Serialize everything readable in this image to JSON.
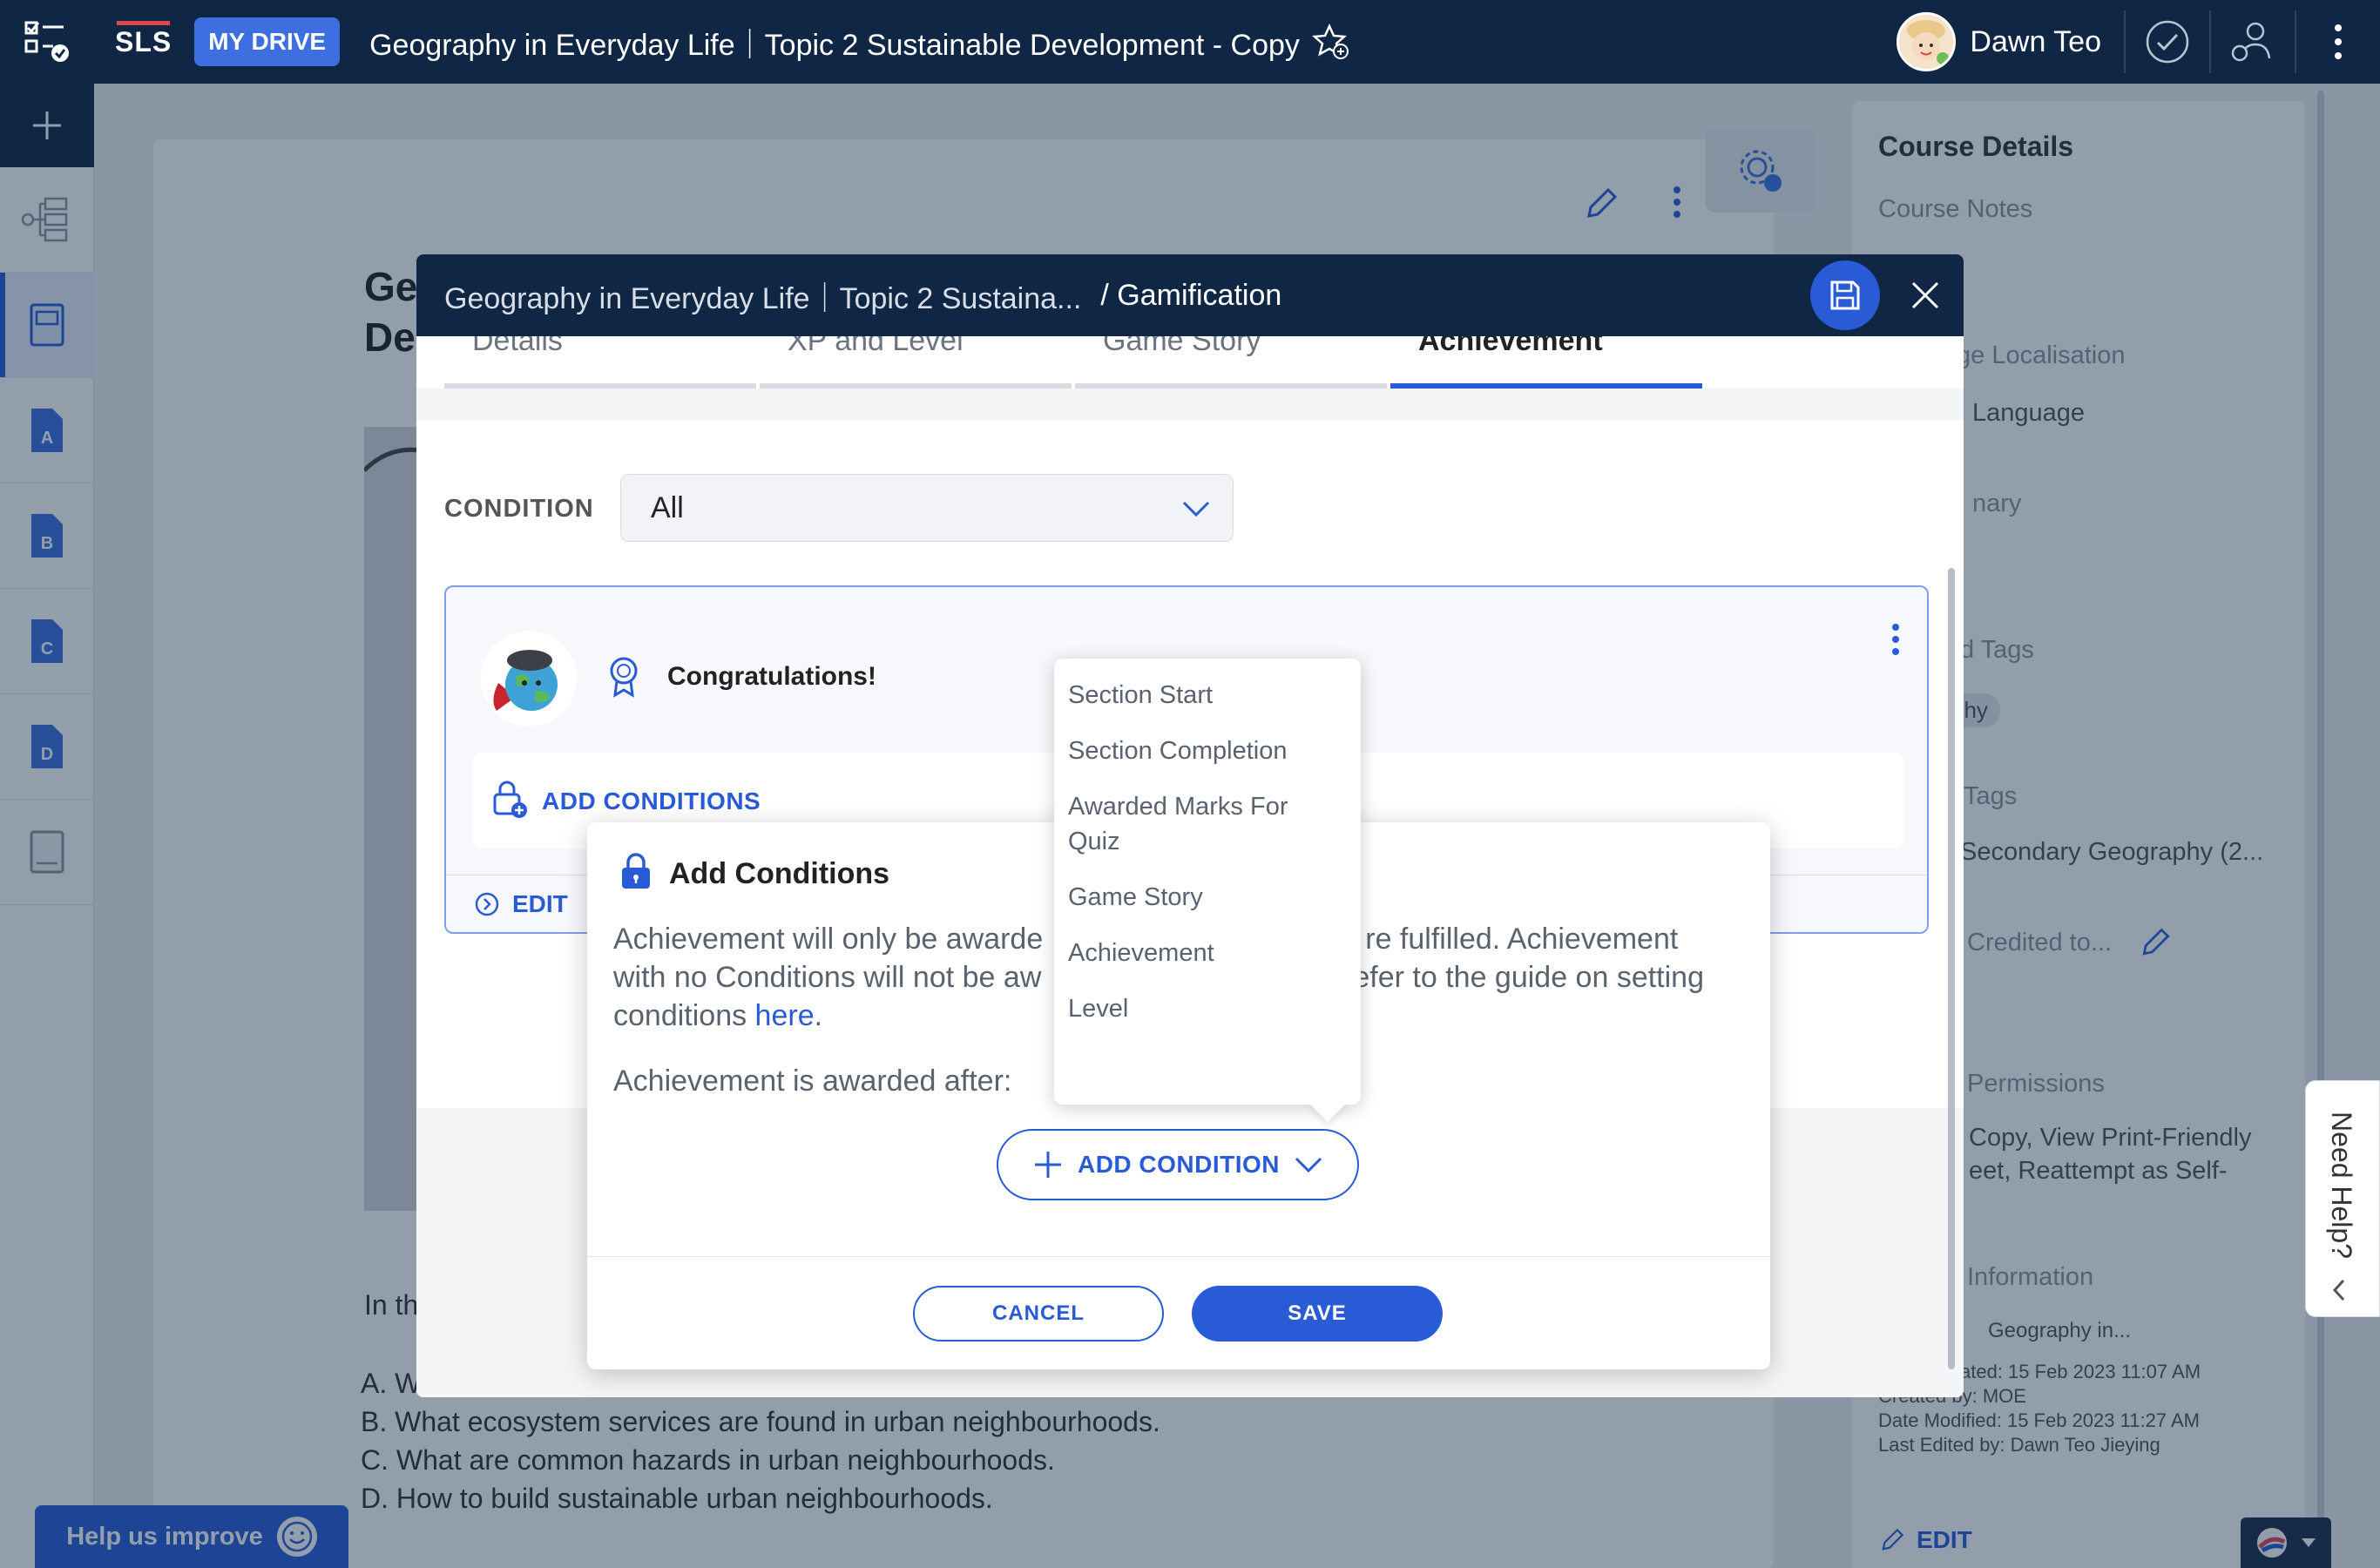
{
  "topbar": {
    "logo": "SLS",
    "my_drive": "MY DRIVE",
    "title": "Geography in Everyday Life｜Topic 2 Sustainable Development - Copy",
    "user_name": "Dawn Teo",
    "icons": [
      "tasks-icon",
      "star-add-icon",
      "check-circle-icon",
      "user-switch-icon",
      "kebab-icon"
    ]
  },
  "leftnav": {
    "items": [
      {
        "name": "add",
        "icon": "plus-icon"
      },
      {
        "name": "lesson-map",
        "icon": "tree-icon"
      },
      {
        "name": "cover",
        "icon": "page-icon"
      },
      {
        "name": "section-a",
        "label": "A"
      },
      {
        "name": "section-b",
        "label": "B"
      },
      {
        "name": "section-c",
        "label": "C"
      },
      {
        "name": "section-d",
        "label": "D"
      },
      {
        "name": "end",
        "icon": "page-icon"
      }
    ]
  },
  "background_page": {
    "title_line1": "Ge",
    "title_line2": "De",
    "question_prefix": "In th",
    "options": [
      "A. W",
      "B. What ecosystem services are found in urban neighbourhoods.",
      "C. What are common hazards in urban neighbourhoods.",
      "D. How to build sustainable urban neighbourhoods."
    ]
  },
  "side_panel": {
    "title": "Course Details",
    "course_notes": "Course Notes",
    "localisation": "ge Localisation",
    "language": "Language",
    "dictionary": "nary",
    "subject_tags": "d Tags",
    "subject_chip": "phy",
    "level_tags": "Tags",
    "level_value": "Secondary Geography (2...",
    "credited": "Credited to...",
    "permissions": "Permissions",
    "permissions_value_1": "Copy, View Print-Friendly",
    "permissions_value_2": "eet, Reattempt as Self-",
    "information": "Information",
    "info_path": "Geography in...",
    "created": "ated: 15 Feb 2023 11:07 AM",
    "created_by": "Created by: MOE",
    "modified": "Date Modified: 15 Feb 2023 11:27 AM",
    "last_edited": "Last Edited by: Dawn Teo Jieying",
    "edit": "EDIT"
  },
  "help_improve": "Help us improve",
  "need_help": "Need Help?",
  "modal": {
    "breadcrumb": "Geography in Everyday Life｜Topic 2 Sustaina...",
    "section": "/ Gamification",
    "tabs": [
      {
        "label": "Details",
        "active": false
      },
      {
        "label": "XP and Level",
        "active": false
      },
      {
        "label": "Game Story",
        "active": false
      },
      {
        "label": "Achievement",
        "active": true
      }
    ],
    "condition_label": "CONDITION",
    "condition_value": "All",
    "achievement": {
      "title": "Congratulations!",
      "add_conditions": "ADD CONDITIONS",
      "edit": "EDIT"
    }
  },
  "popover": {
    "title": "Add Conditions",
    "desc_part1": "Achievement will only be awarde",
    "desc_part2": "re fulfilled. Achievement",
    "desc_line2_part1": "with no Conditions will not be aw",
    "desc_line2_part2": "efer to the guide on setting",
    "desc_line3": "conditions ",
    "desc_link": "here",
    "desc_end": ".",
    "awarded_after": "Achievement is awarded after:",
    "add_condition": "ADD CONDITION",
    "cancel": "CANCEL",
    "save": "SAVE"
  },
  "dropdown": {
    "items": [
      "Section Start",
      "Section Completion",
      "Awarded Marks For Quiz",
      "Game Story",
      "Achievement",
      "Level"
    ]
  },
  "colors": {
    "navy": "#0f2745",
    "accent": "#2a5bd7",
    "my_drive": "#3d6fe0"
  }
}
